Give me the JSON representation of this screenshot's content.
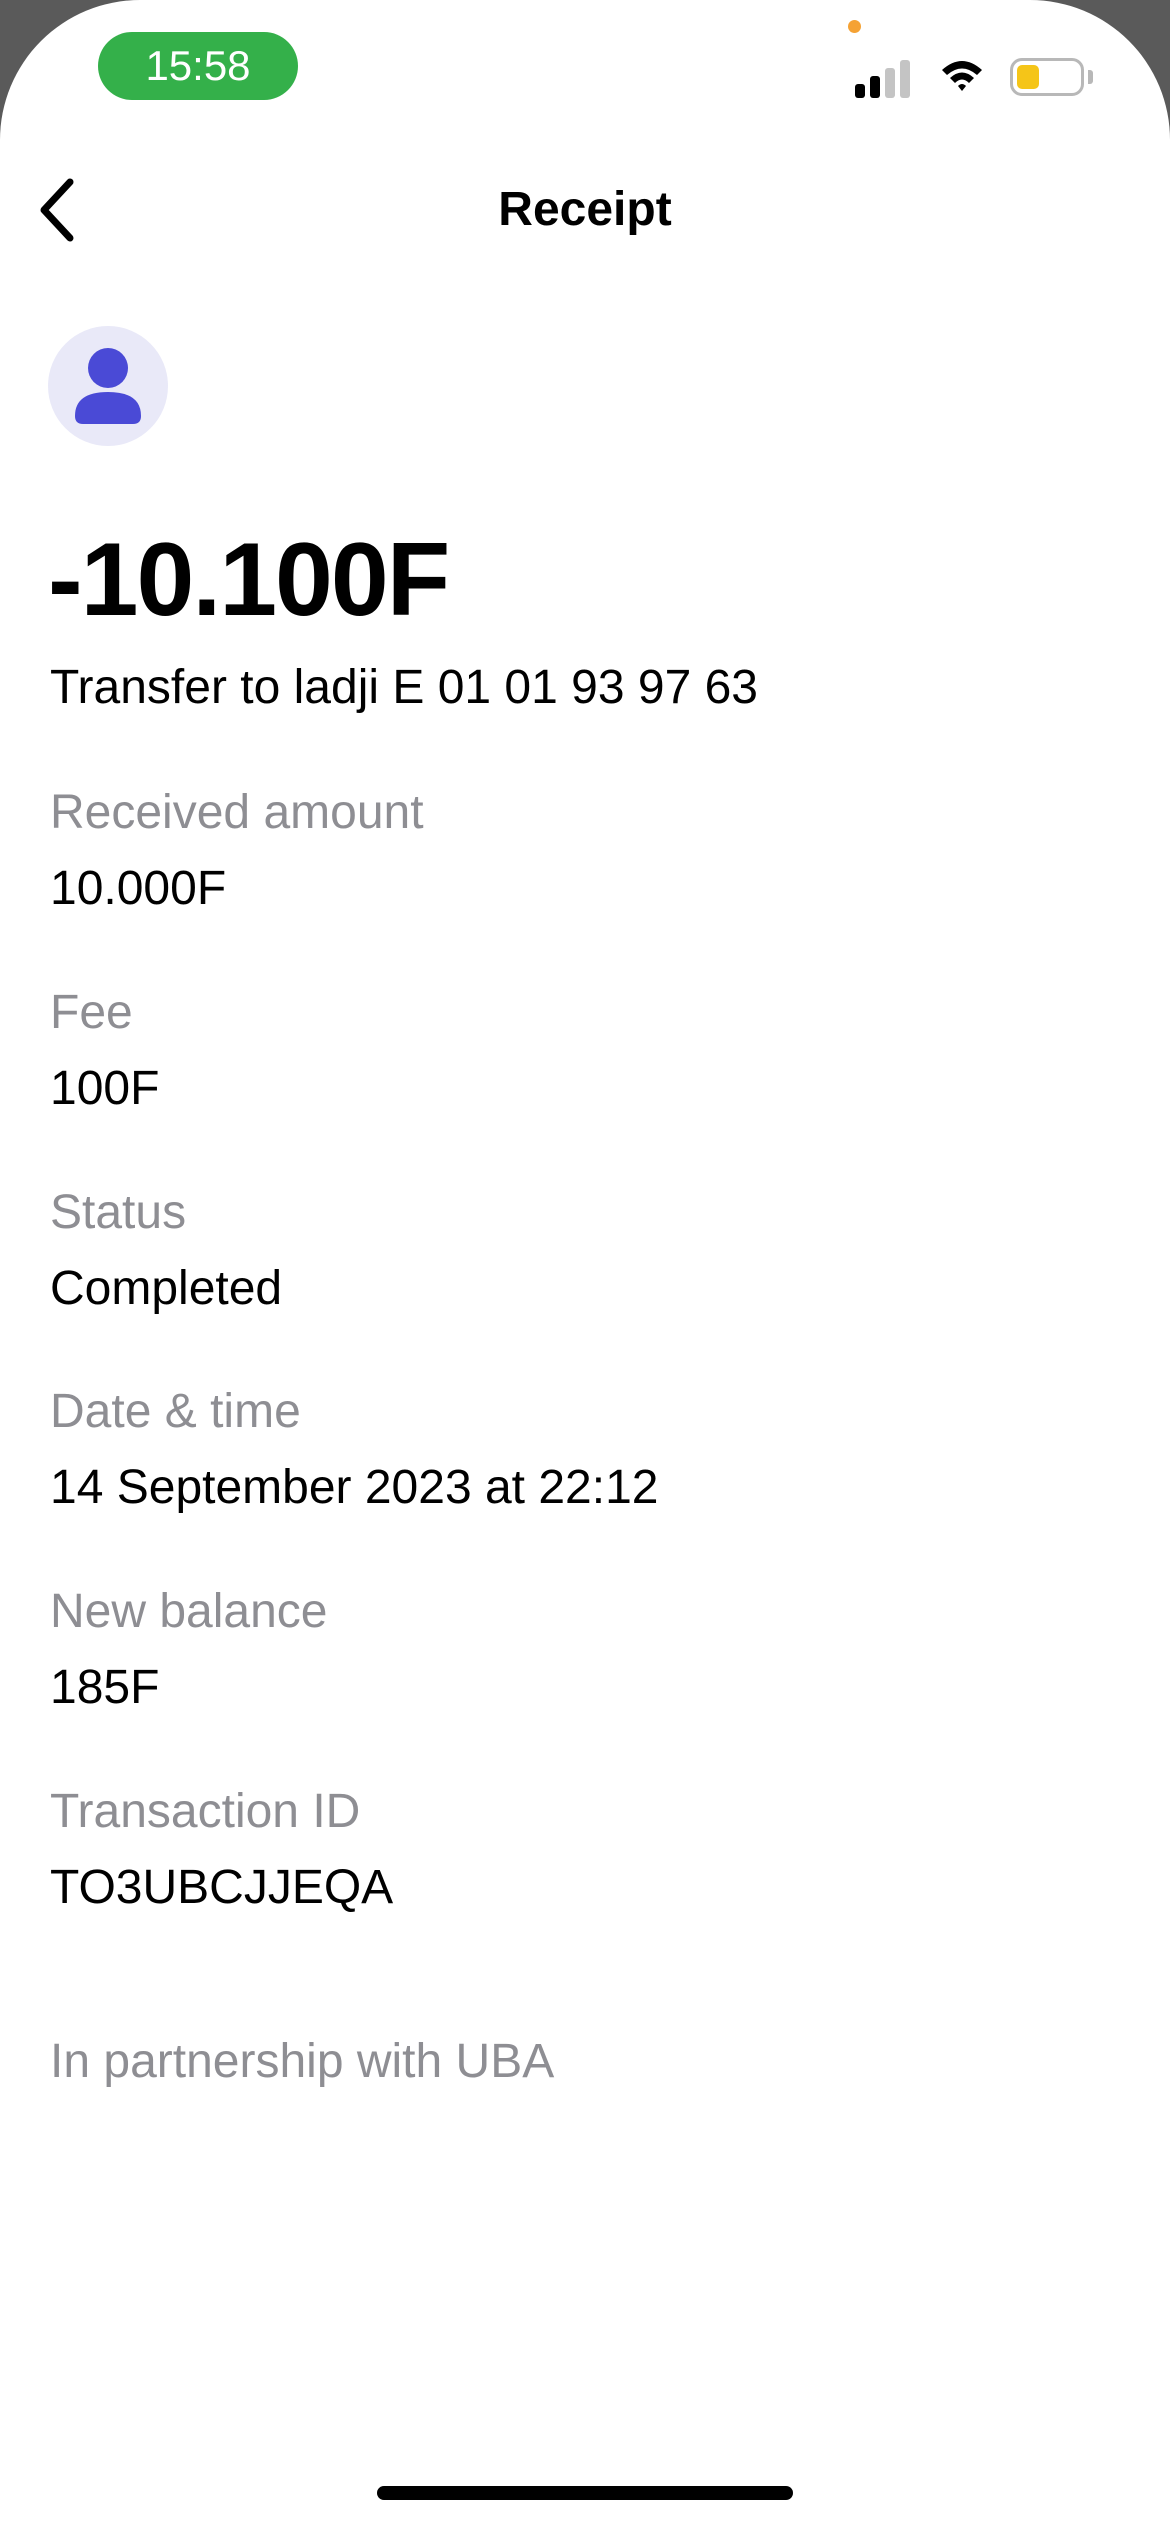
{
  "status_bar": {
    "time": "15:58",
    "accent_time_bg": "#34b04a",
    "battery_color": "#f5c518"
  },
  "nav": {
    "back_icon": "chevron-left-icon",
    "title": "Receipt"
  },
  "avatar": {
    "icon": "user-icon",
    "color": "#4a4ad6"
  },
  "transaction": {
    "amount": "-10.100F",
    "description": "Transfer to ladji E 01 01 93 97 63"
  },
  "fields": {
    "received": {
      "label": "Received amount",
      "value": "10.000F"
    },
    "fee": {
      "label": "Fee",
      "value": "100F"
    },
    "status": {
      "label": "Status",
      "value": "Completed"
    },
    "datetime": {
      "label": "Date & time",
      "value": "14 September 2023 at 22:12"
    },
    "balance": {
      "label": "New balance",
      "value": "185F"
    },
    "txid": {
      "label": "Transaction ID",
      "value": "TO3UBCJJEQA"
    }
  },
  "footer": {
    "partner": "In partnership with UBA"
  }
}
